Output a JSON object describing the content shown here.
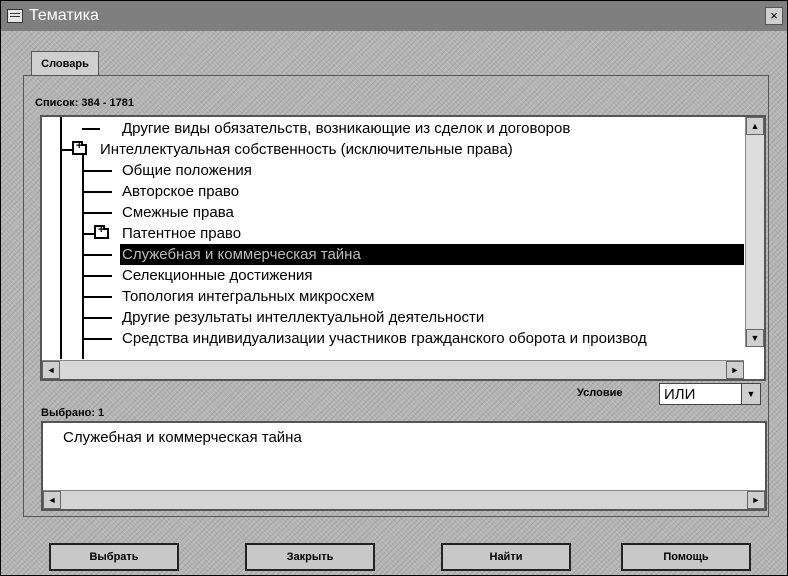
{
  "window": {
    "title": "Тематика",
    "close_label": "×"
  },
  "tab": {
    "label": "Словарь"
  },
  "list": {
    "label": "Список: 384 - 1781",
    "items": [
      "Другие виды обязательств, возникающие из сделок и договоров",
      "Интеллектуальная собственность (исключительные права)",
      "Общие положения",
      "Авторское право",
      "Смежные права",
      "Патентное право",
      "Служебная и коммерческая тайна",
      "Селекционные достижения",
      "Топология интегральных микросхем",
      "Другие результаты интеллектуальной деятельности",
      "Средства индивидуализации участников гражданского оборота и производ"
    ],
    "selected": "Служебная и коммерческая тайна",
    "folder_glyph": "+"
  },
  "condition": {
    "label": "Условие",
    "value": "ИЛИ"
  },
  "chosen": {
    "label": "Выбрано: 1",
    "items": [
      "Служебная и коммерческая тайна"
    ]
  },
  "buttons": {
    "select": "Выбрать",
    "close": "Закрыть",
    "find": "Найти",
    "help": "Помощь"
  },
  "icons": {
    "scroll_up": "▲",
    "scroll_down": "▼",
    "scroll_left": "◄",
    "scroll_right": "►",
    "dropdown": "▼"
  }
}
